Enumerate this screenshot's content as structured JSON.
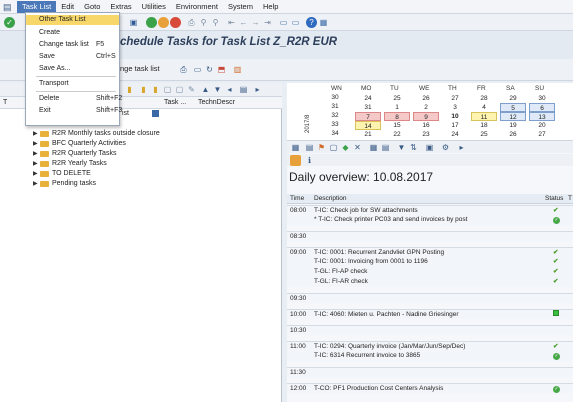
{
  "menubar": {
    "items": [
      "Task List",
      "Edit",
      "Goto",
      "Extras",
      "Utilities",
      "Environment",
      "System",
      "Help"
    ]
  },
  "title": "chedule Tasks for Task List Z_R2R EUR",
  "toolbar2": {
    "label": "nge task list"
  },
  "dropdown": {
    "items": [
      {
        "label": "Other Task List",
        "shortcut": ""
      },
      {
        "label": "Create",
        "shortcut": ""
      },
      {
        "label": "Change task list",
        "shortcut": "F5"
      },
      {
        "label": "Save",
        "shortcut": "Ctrl+S"
      },
      {
        "label": "Save As...",
        "shortcut": ""
      },
      {
        "label": "Transport",
        "shortcut": ""
      },
      {
        "label": "Delete",
        "shortcut": "Shift+F2"
      },
      {
        "label": "Exit",
        "shortcut": "Shift+F3"
      }
    ]
  },
  "tree": {
    "header": {
      "col1": "T",
      "col2": "Task ...",
      "col3": "TechnDescr"
    },
    "partial_row": "ist",
    "items": [
      "R2R Monthly tasks outside closure",
      "BFC Quarterly Activities",
      "R2R Quarterly Tasks",
      "R2R Yearly Tasks",
      "TO DELETE",
      "Pending tasks"
    ]
  },
  "calendar": {
    "headers": [
      "WN",
      "MO",
      "TU",
      "WE",
      "TH",
      "FR",
      "SA",
      "SU"
    ],
    "year": "2017/8",
    "rows": [
      [
        "30",
        "24",
        "25",
        "26",
        "27",
        "28",
        "29",
        "30"
      ],
      [
        "31",
        "31",
        "1",
        "2",
        "3",
        "4",
        "5",
        "6"
      ],
      [
        "32",
        "7",
        "8",
        "9",
        "10",
        "11",
        "12",
        "13"
      ],
      [
        "33",
        "14",
        "15",
        "16",
        "17",
        "18",
        "19",
        "20"
      ],
      [
        "34",
        "21",
        "22",
        "23",
        "24",
        "25",
        "26",
        "27"
      ]
    ]
  },
  "overview": {
    "title": "Daily overview: 10.08.2017",
    "columns": {
      "time": "Time",
      "description": "Description",
      "status": "Status",
      "extra": "T"
    },
    "rows": [
      {
        "time": "08:00",
        "desc": "T-IC: Check job for SW attachments",
        "status": "check"
      },
      {
        "time": "",
        "desc": "* T-IC: Check printer PC03 and send invoices by post",
        "status": "ok"
      },
      {
        "time": "08:30",
        "desc": "",
        "status": ""
      },
      {
        "time": "09:00",
        "desc": "T-IC: 0001: Recurrent Zandvliet GPN Posting",
        "status": "check"
      },
      {
        "time": "",
        "desc": "T-IC: 0001: Invoicing from 0001 to 1196",
        "status": "check"
      },
      {
        "time": "",
        "desc": "T-GL: FI-AP check",
        "status": "check"
      },
      {
        "time": "",
        "desc": "T-GL: FI-AR check",
        "status": "check"
      },
      {
        "time": "09:30",
        "desc": "",
        "status": ""
      },
      {
        "time": "10:00",
        "desc": "T-IC: 4060: Mieten u. Pachten - Nadine Griesinger",
        "status": "square"
      },
      {
        "time": "10:30",
        "desc": "",
        "status": ""
      },
      {
        "time": "11:00",
        "desc": "T-IC: 0294: Quarterly invoice (Jan/Mar/Jun/Sep/Dec)",
        "status": "check"
      },
      {
        "time": "",
        "desc": "T-IC: 6314 Recurrent invoice to 3865",
        "status": "ok"
      },
      {
        "time": "11:30",
        "desc": "",
        "status": ""
      },
      {
        "time": "12:00",
        "desc": "T-CO: PF1 Production Cost Centers Analysis",
        "status": "ok"
      }
    ]
  }
}
